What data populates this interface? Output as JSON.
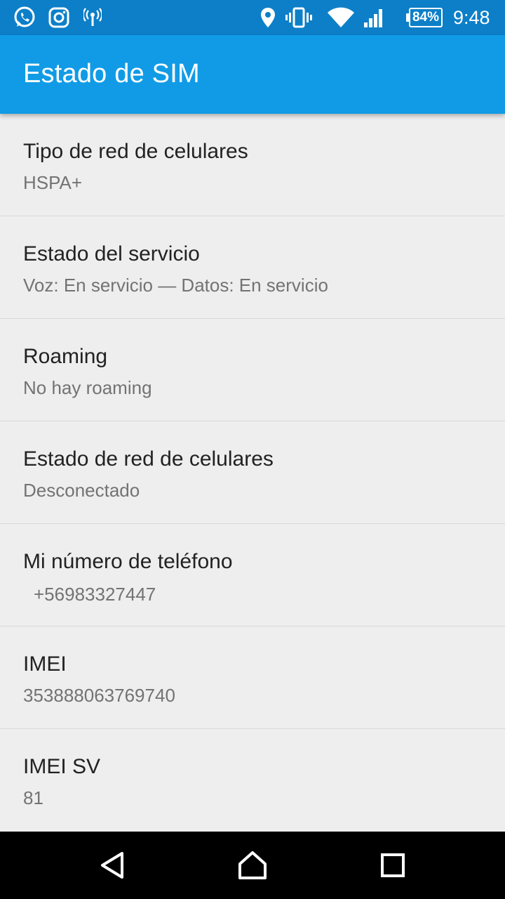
{
  "status_bar": {
    "left_icons": [
      "whatsapp-icon",
      "instagram-icon",
      "hotspot-icon"
    ],
    "right_icons": [
      "location-icon",
      "vibrate-icon",
      "wifi-icon",
      "cell-signal-icon"
    ],
    "battery": "84%",
    "time": "9:48"
  },
  "app_bar": {
    "title": "Estado de SIM"
  },
  "items": [
    {
      "title": "Tipo de red de celulares",
      "summary": "HSPA+"
    },
    {
      "title": "Estado del servicio",
      "summary": "Voz: En servicio — Datos: En servicio"
    },
    {
      "title": "Roaming",
      "summary": "No hay roaming"
    },
    {
      "title": "Estado de red de celulares",
      "summary": "Desconectado"
    },
    {
      "title": "Mi número de teléfono",
      "summary": "+56983327447"
    },
    {
      "title": "IMEI",
      "summary": "353888063769740"
    },
    {
      "title": "IMEI SV",
      "summary": "81"
    }
  ],
  "nav_bar": {
    "buttons": [
      "back-icon",
      "home-icon",
      "recents-icon"
    ]
  },
  "colors": {
    "status_bar": "#0d7fc8",
    "app_bar": "#119be6",
    "background": "#eeeeee"
  }
}
